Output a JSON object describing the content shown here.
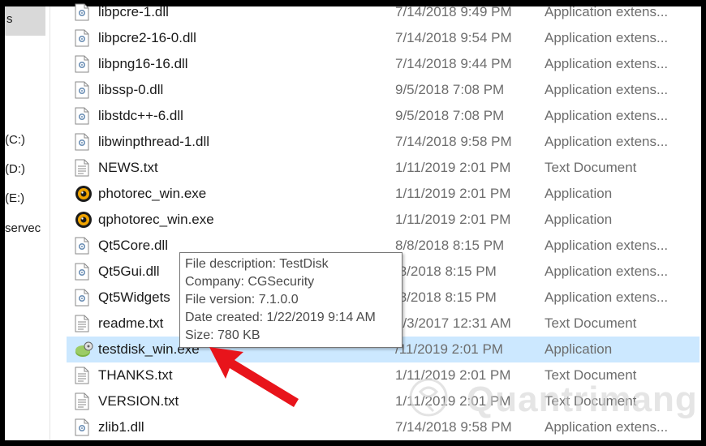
{
  "nav": {
    "items": [
      {
        "label": "s"
      },
      {
        "label": "(C:)"
      },
      {
        "label": "(D:)"
      },
      {
        "label": "(E:)"
      },
      {
        "label": "servec"
      }
    ]
  },
  "files": [
    {
      "name": "libpcre-1.dll",
      "date": "7/14/2018 9:49 PM",
      "type": "Application extens...",
      "icon": "dll-icon"
    },
    {
      "name": "libpcre2-16-0.dll",
      "date": "7/14/2018 9:54 PM",
      "type": "Application extens...",
      "icon": "dll-icon"
    },
    {
      "name": "libpng16-16.dll",
      "date": "7/14/2018 9:44 PM",
      "type": "Application extens...",
      "icon": "dll-icon"
    },
    {
      "name": "libssp-0.dll",
      "date": "9/5/2018 7:08 PM",
      "type": "Application extens...",
      "icon": "dll-icon"
    },
    {
      "name": "libstdc++-6.dll",
      "date": "9/5/2018 7:08 PM",
      "type": "Application extens...",
      "icon": "dll-icon"
    },
    {
      "name": "libwinpthread-1.dll",
      "date": "7/14/2018 9:58 PM",
      "type": "Application extens...",
      "icon": "dll-icon"
    },
    {
      "name": "NEWS.txt",
      "date": "1/11/2019 2:01 PM",
      "type": "Text Document",
      "icon": "text-file-icon"
    },
    {
      "name": "photorec_win.exe",
      "date": "1/11/2019 2:01 PM",
      "type": "Application",
      "icon": "photorec-icon"
    },
    {
      "name": "qphotorec_win.exe",
      "date": "1/11/2019 2:01 PM",
      "type": "Application",
      "icon": "photorec-icon"
    },
    {
      "name": "Qt5Core.dll",
      "date": "8/8/2018 8:15 PM",
      "type": "Application extens...",
      "icon": "dll-icon"
    },
    {
      "name": "Qt5Gui.dll",
      "date": "/8/2018 8:15 PM",
      "type": "Application extens...",
      "icon": "dll-icon"
    },
    {
      "name": "Qt5Widgets",
      "date": "/8/2018 8:15 PM",
      "type": "Application extens...",
      "icon": "dll-icon"
    },
    {
      "name": "readme.txt",
      "date": "2/3/2017 12:31 AM",
      "type": "Text Document",
      "icon": "text-file-icon"
    },
    {
      "name": "testdisk_win.exe",
      "date": "/11/2019 2:01 PM",
      "type": "Application",
      "icon": "testdisk-icon",
      "selected": true
    },
    {
      "name": "THANKS.txt",
      "date": "1/11/2019 2:01 PM",
      "type": "Text Document",
      "icon": "text-file-icon"
    },
    {
      "name": "VERSION.txt",
      "date": "1/11/2019 2:01 PM",
      "type": "Text Document",
      "icon": "text-file-icon"
    },
    {
      "name": "zlib1.dll",
      "date": "7/14/2018 9:58 PM",
      "type": "Application extens...",
      "icon": "dll-icon"
    }
  ],
  "tooltip": {
    "lines": [
      "File description: TestDisk",
      "Company: CGSecurity",
      "File version: 7.1.0.0",
      "Date created: 1/22/2019 9:14 AM",
      "Size: 780 KB"
    ]
  },
  "watermark": {
    "text": "Quantrimang"
  },
  "colors": {
    "selection": "#cce8ff",
    "arrow": "#e8141b",
    "secondary_text": "#6d6d6d"
  }
}
